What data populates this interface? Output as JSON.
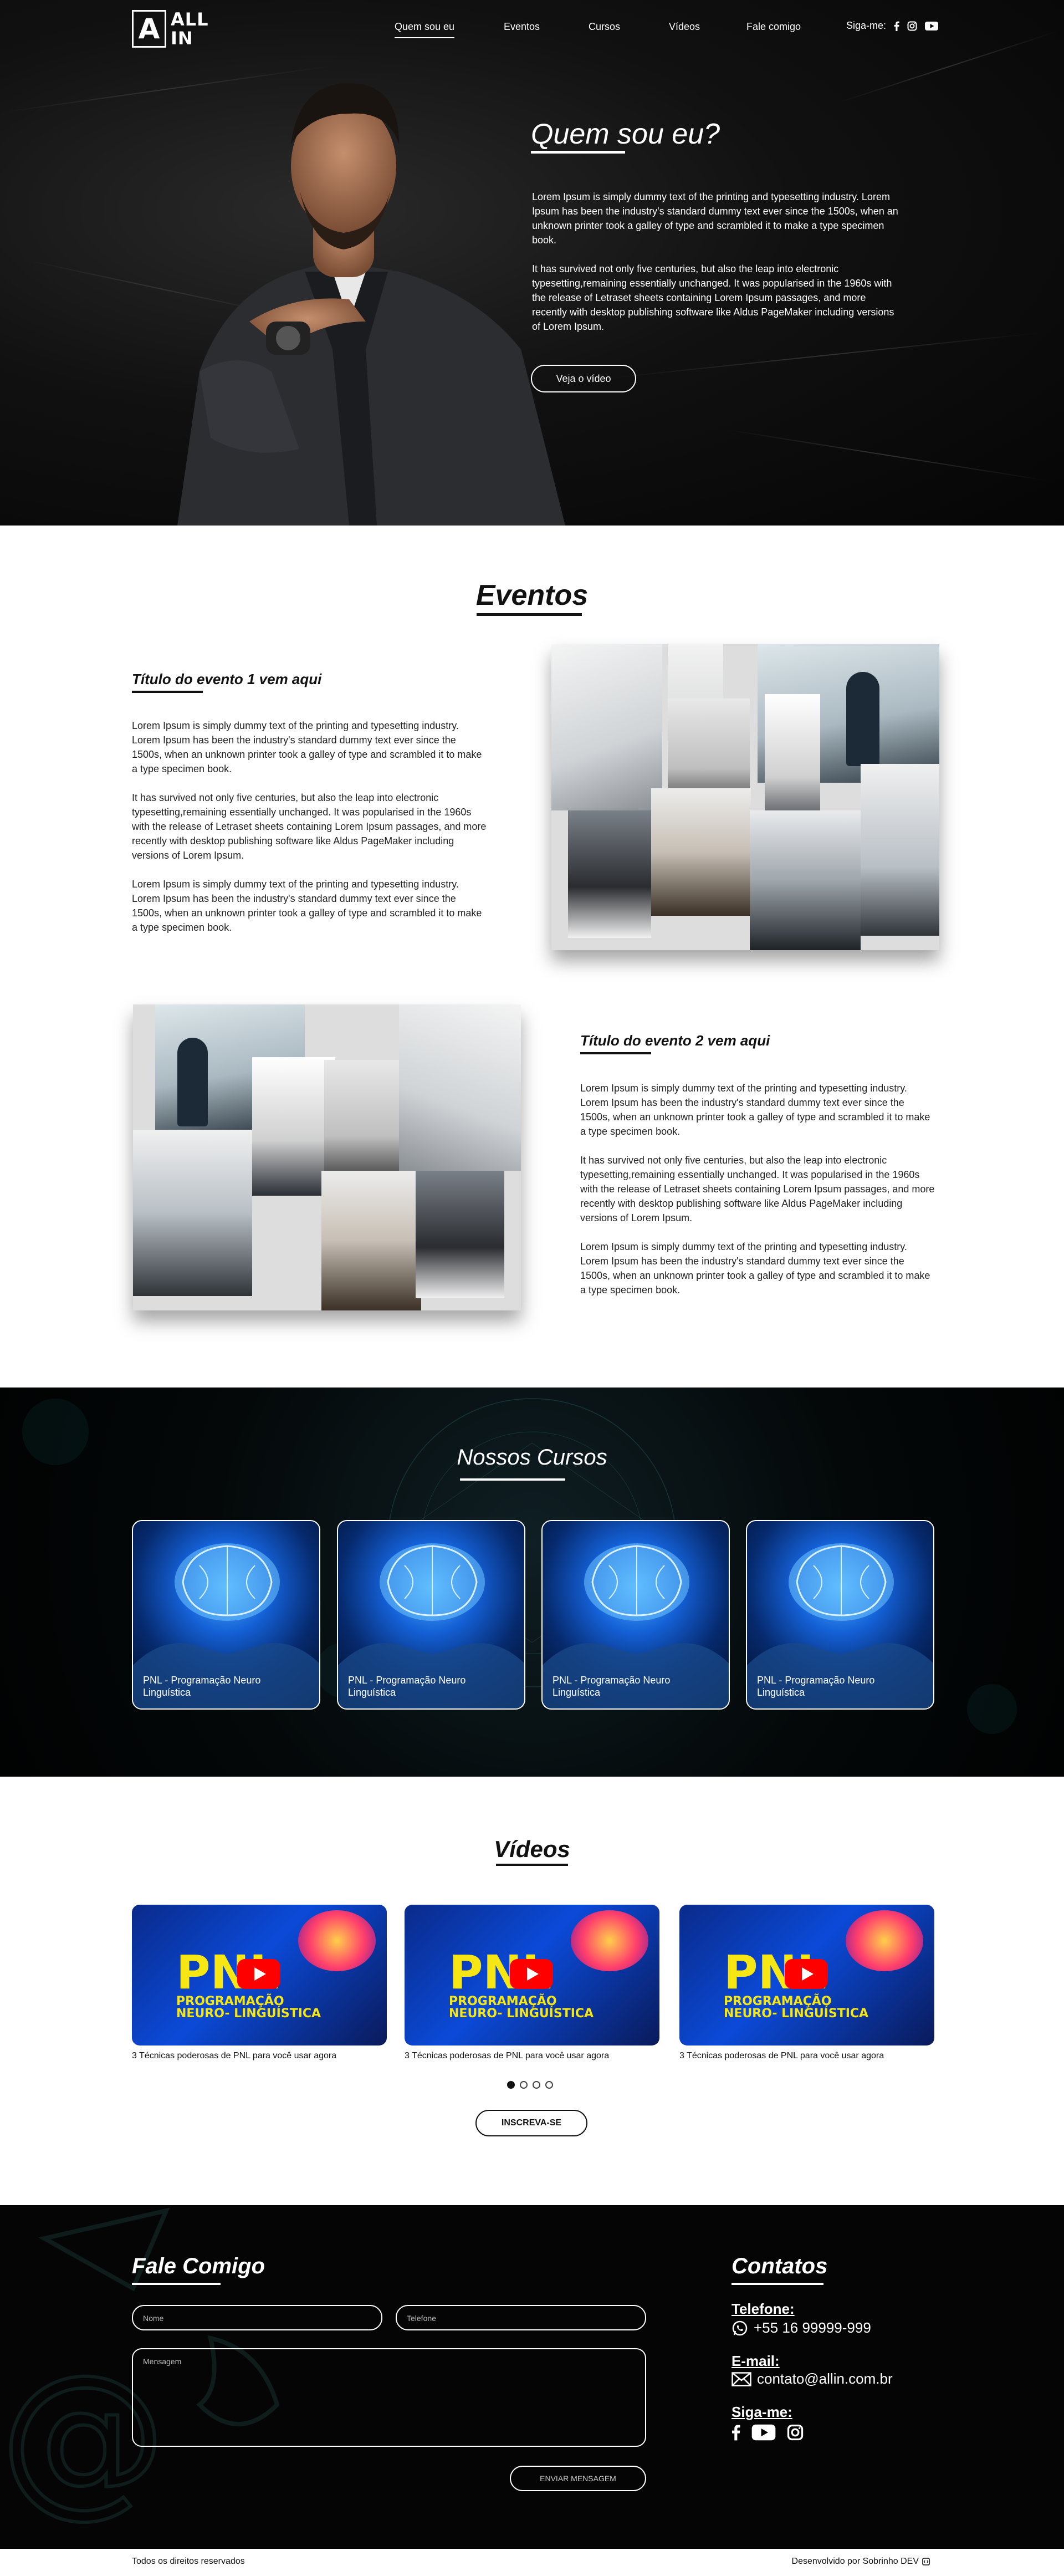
{
  "header": {
    "logo_letter": "A",
    "logo_line1": "ALL",
    "logo_line2": "IN",
    "nav": [
      {
        "label": "Quem sou eu",
        "active": true
      },
      {
        "label": "Eventos"
      },
      {
        "label": "Cursos"
      },
      {
        "label": "Vídeos"
      },
      {
        "label": "Fale comigo"
      }
    ],
    "follow_label": "Siga-me:",
    "social_icons": [
      "facebook-icon",
      "instagram-icon",
      "youtube-icon"
    ]
  },
  "hero": {
    "title": "Quem sou eu?",
    "paragraph1": "Lorem Ipsum is simply dummy text of the printing and typesetting industry. Lorem Ipsum has been the industry's standard dummy text ever since the 1500s, when an unknown printer took a galley of type and scrambled it to make a type specimen book.",
    "paragraph2": "It has survived not only five centuries, but also the leap into electronic typesetting,remaining essentially unchanged. It was popularised in the 1960s with the release of Letraset sheets containing Lorem Ipsum passages, and more recently with desktop publishing software like Aldus PageMaker including versions of Lorem Ipsum.",
    "button": "Veja o vídeo"
  },
  "events": {
    "title": "Eventos",
    "items": [
      {
        "title": "Título do evento 1 vem aqui",
        "p1": "Lorem Ipsum is simply dummy text of the printing and typesetting industry. Lorem Ipsum has been the industry's standard dummy text ever since the 1500s, when an unknown printer took a galley of type and scrambled it to make a type specimen book.",
        "p2": "It has survived not only five centuries, but also the leap into electronic typesetting,remaining essentially unchanged. It was popularised in the 1960s with the release of Letraset sheets containing Lorem Ipsum passages, and more recently with desktop publishing software like Aldus PageMaker including versions of Lorem Ipsum.",
        "p3": "Lorem Ipsum is simply dummy text of the printing and typesetting industry. Lorem Ipsum has been the industry's standard dummy text ever since the 1500s, when an unknown printer took a galley of type and scrambled it to make a type specimen book."
      },
      {
        "title": "Título do evento 2 vem aqui",
        "p1": "Lorem Ipsum is simply dummy text of the printing and typesetting industry. Lorem Ipsum has been the industry's standard dummy text ever since the 1500s, when an unknown printer took a galley of type and scrambled it to make a type specimen book.",
        "p2": "It has survived not only five centuries, but also the leap into electronic typesetting,remaining essentially unchanged. It was popularised in the 1960s with the release of Letraset sheets containing Lorem Ipsum passages, and more recently with desktop publishing software like Aldus PageMaker including versions of Lorem Ipsum.",
        "p3": "Lorem Ipsum is simply dummy text of the printing and typesetting industry. Lorem Ipsum has been the industry's standard dummy text ever since the 1500s, when an unknown printer took a galley of type and scrambled it to make a type specimen book."
      }
    ]
  },
  "courses": {
    "title": "Nossos Cursos",
    "cards": [
      {
        "label": "PNL - Programação Neuro Linguística"
      },
      {
        "label": "PNL - Programação Neuro Linguística"
      },
      {
        "label": "PNL - Programação Neuro Linguística"
      },
      {
        "label": "PNL - Programação Neuro Linguística"
      }
    ]
  },
  "videos": {
    "title": "Vídeos",
    "thumb_big": "PNL",
    "thumb_sub": "PROGRAMAÇÃO NEURO- LINGUÍSTICA",
    "items": [
      {
        "caption": "3 Técnicas poderosas de PNL para você usar agora"
      },
      {
        "caption": "3 Técnicas poderosas de PNL para você usar agora"
      },
      {
        "caption": "3 Técnicas poderosas de PNL para você usar agora"
      }
    ],
    "pages": 4,
    "active_page": 1,
    "subscribe": "INSCREVA-SE"
  },
  "contact": {
    "title": "Fale Comigo",
    "name_placeholder": "Nome",
    "phone_placeholder": "Telefone",
    "message_placeholder": "Mensagem",
    "send": "ENVIAR MENSAGEM",
    "info_title": "Contatos",
    "phone_label": "Telefone:",
    "phone_value": "+55 16 99999-999",
    "email_label": "E-mail:",
    "email_value": "contato@allin.com.br",
    "follow_label": "Siga-me:"
  },
  "footer": {
    "left": "Todos os direitos reservados",
    "right": "Desenvolvido por Sobrinho DEV"
  },
  "colors": {
    "dark": "#050505",
    "white": "#ffffff",
    "accent_blue": "#1460d6",
    "thumb_yellow": "#f5e614",
    "youtube_red": "#ff0000"
  }
}
